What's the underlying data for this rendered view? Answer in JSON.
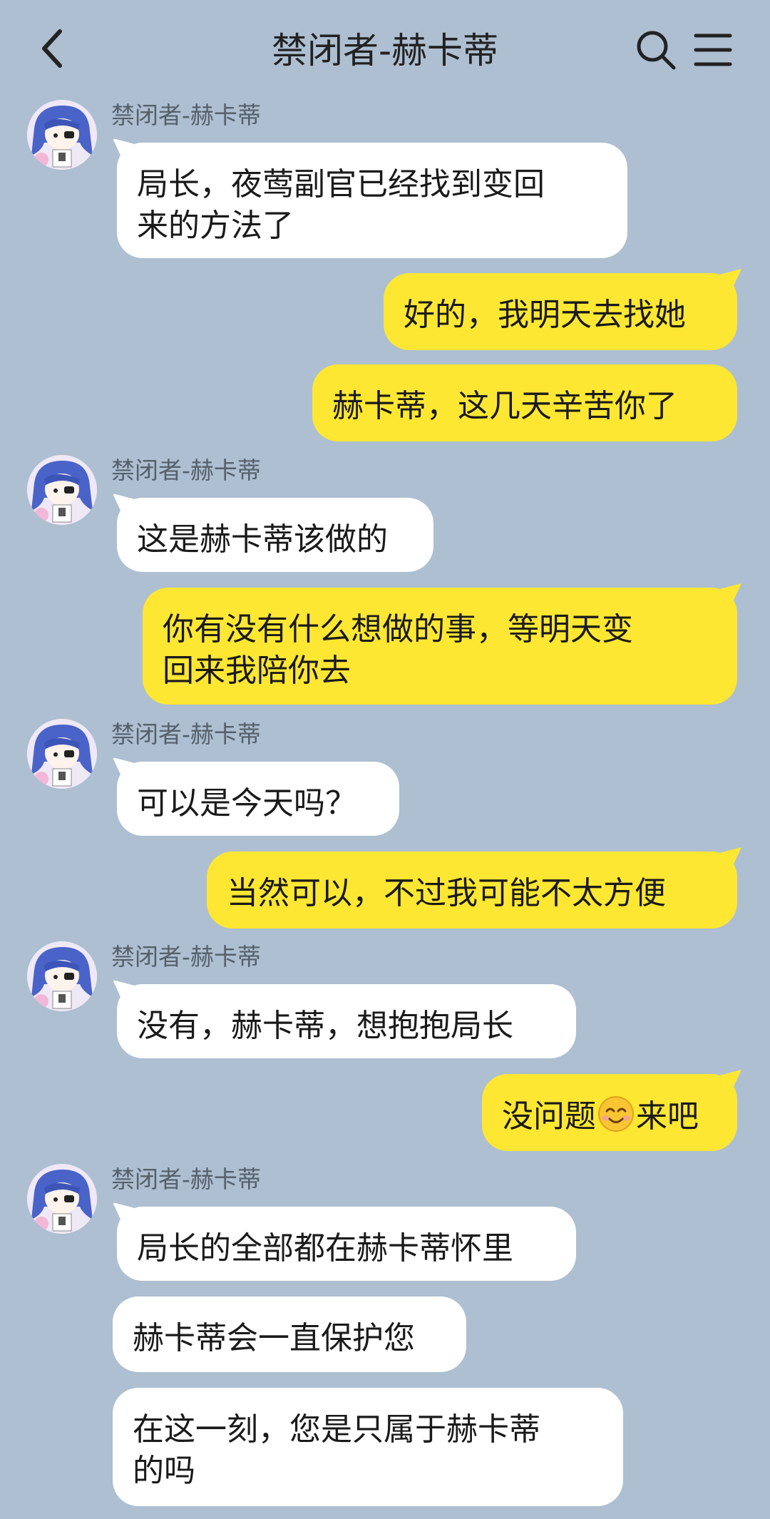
{
  "header": {
    "title": "禁闭者-赫卡蒂",
    "back_icon": "chevron-left-icon",
    "search_icon": "search-icon",
    "menu_icon": "menu-icon"
  },
  "sender": {
    "name": "禁闭者-赫卡蒂"
  },
  "messages": [
    {
      "side": "in",
      "text_line1": "局长，夜莺副官已经找到变回",
      "text_line2": "来的方法了"
    },
    {
      "side": "out",
      "text": "好的，我明天去找她"
    },
    {
      "side": "out",
      "text": "赫卡蒂，这几天辛苦你了"
    },
    {
      "side": "in",
      "text": "这是赫卡蒂该做的"
    },
    {
      "side": "out",
      "text_line1": "你有没有什么想做的事，等明天变",
      "text_line2": "回来我陪你去"
    },
    {
      "side": "in",
      "text": "可以是今天吗？"
    },
    {
      "side": "out",
      "text": "当然可以，不过我可能不太方便"
    },
    {
      "side": "in",
      "text": "没有，赫卡蒂，想抱抱局长"
    },
    {
      "side": "out",
      "text_before": "没问题",
      "emoji": "smiling-face-emoji",
      "text_after": "来吧"
    },
    {
      "side": "in",
      "text": "局长的全部都在赫卡蒂怀里"
    },
    {
      "side": "in",
      "text": "赫卡蒂会一直保护您"
    },
    {
      "side": "in",
      "text_line1": "在这一刻，您是只属于赫卡蒂",
      "text_line2": "的吗"
    }
  ],
  "colors": {
    "background": "#adbfd1",
    "incoming_bubble": "#ffffff",
    "outgoing_bubble": "#fde733"
  }
}
